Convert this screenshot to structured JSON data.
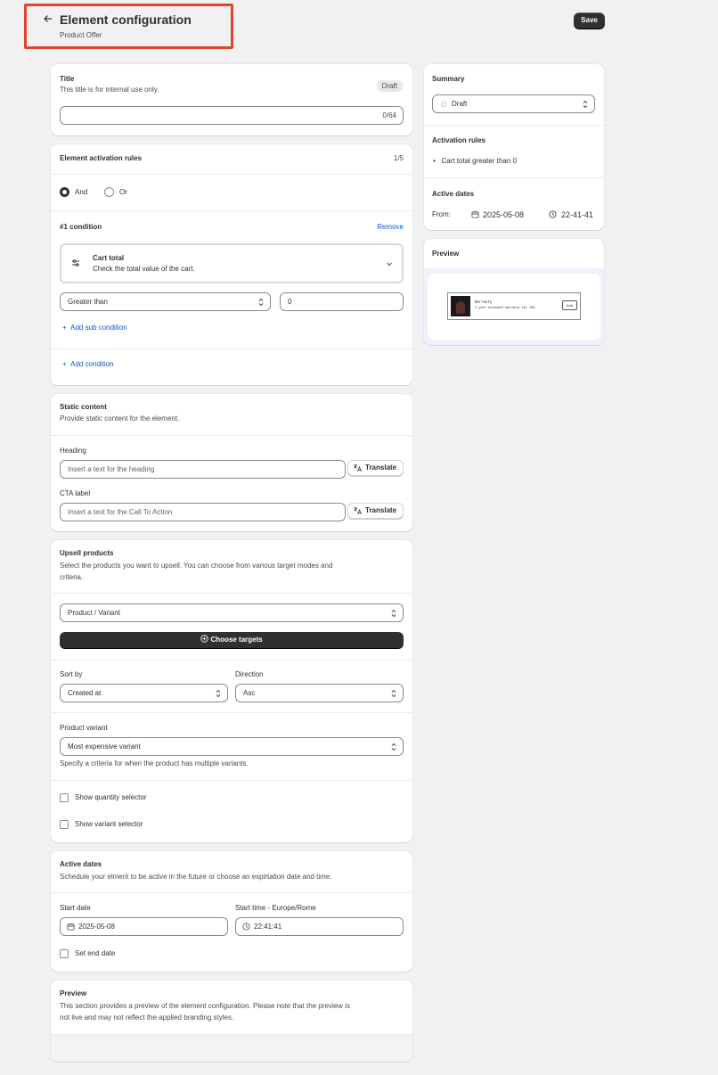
{
  "header": {
    "title": "Element configuration",
    "subtitle": "Product Offer",
    "save": "Save"
  },
  "title_card": {
    "label": "Title",
    "help": "This title is for internal use only.",
    "badge": "Draft",
    "counter": "0/64"
  },
  "rules": {
    "heading": "Element activation rules",
    "count": "1/5",
    "and_label": "And",
    "or_label": "Or",
    "condition_label": "#1 condition",
    "remove": "Remove",
    "cond_title": "Cart total",
    "cond_desc": "Check the total value of the cart.",
    "operator": "Greater than",
    "value": "0",
    "add_sub": "Add sub condition",
    "add_condition": "Add condition"
  },
  "static": {
    "heading": "Static content",
    "help": "Provide static content for the element.",
    "heading_label": "Heading",
    "heading_ph": "Insert a text for the heading",
    "cta_label": "CTA label",
    "cta_ph": "Insert a text for the Call To Action",
    "translate": "Translate"
  },
  "upsell": {
    "heading": "Upsell products",
    "help_1": "Select the products you want to upsell. You can choose from various target modes and",
    "help_2": "criteria.",
    "mode": "Product / Variant",
    "choose": "Choose targets",
    "sort_label": "Sort by",
    "sort_value": "Created at",
    "dir_label": "Direction",
    "dir_value": "Asc",
    "variant_label": "Product variant",
    "variant_value": "Most expensive variant",
    "variant_help": "Specify a criteria for when the product has multiple variants.",
    "show_qty": "Show quantity selector",
    "show_variant": "Show variant selector"
  },
  "active_dates": {
    "heading": "Active dates",
    "help": "Schedule your elment to be active in the future or choose an expirtation date and time.",
    "start_date_label": "Start date",
    "start_date": "2025-05-08",
    "start_time_label": "Start time - Europe/Rome",
    "start_time": "22:41:41",
    "end_label": "Set end date"
  },
  "preview_card": {
    "heading": "Preview",
    "help_1": "This section provides a preview of the element configuration. Please note that the preview is",
    "help_2": "not live and may not reflect the applied branding styles."
  },
  "summary": {
    "heading": "Summary",
    "status": "Draft",
    "rules_heading": "Activation rules",
    "rule_1": "Cart total greater than 0",
    "dates_heading": "Active dates",
    "from": "From:",
    "date": "2025-05-08",
    "time": "22-41-41"
  },
  "side_preview": {
    "heading": "Preview",
    "product_title": "Warranty",
    "product_desc": "3 year extended warranty for 10$",
    "add": "Add"
  },
  "colors": {
    "accent": "#005bd3",
    "primary_button": "#303030",
    "highlight": "#e0452c"
  }
}
